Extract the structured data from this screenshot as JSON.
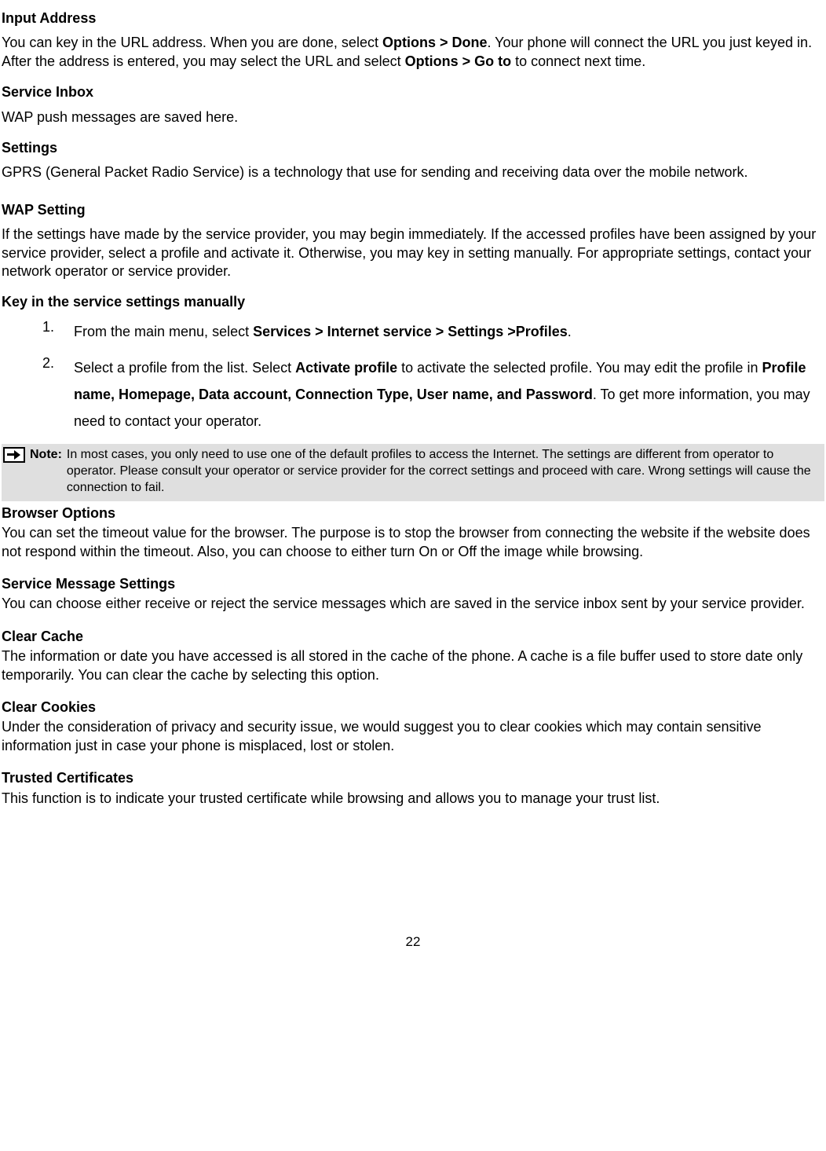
{
  "inputAddress": {
    "heading": "Input Address",
    "p1a": "You can key in the URL address. When you are done, select ",
    "p1b": "Options > Done",
    "p1c": ". Your phone will connect the URL you just keyed in. After the address is entered, you may select the URL and select ",
    "p1d": "Options > Go to",
    "p1e": " to connect next time."
  },
  "serviceInbox": {
    "heading": "Service Inbox",
    "p": "WAP push messages are saved here."
  },
  "settings": {
    "heading": "Settings",
    "p": "GPRS (General Packet Radio Service) is a technology that use for sending and receiving data over the mobile network."
  },
  "wapSetting": {
    "heading": "WAP Setting",
    "p": "If the settings have made by the service provider, you may begin immediately. If the accessed profiles have been assigned by your service provider, select a profile and activate it. Otherwise, you may key in setting manually. For appropriate settings, contact your network operator or service provider."
  },
  "keyInHeading": "Key in the service settings manually",
  "step1": {
    "num": "1.",
    "a": "From the main menu, select ",
    "b": "Services > Internet service > Settings >Profiles",
    "c": "."
  },
  "step2": {
    "num": "2.",
    "a": "Select a profile from the list. Select ",
    "b": "Activate profile",
    "c": " to activate the selected profile. You may edit the profile in ",
    "d": "Profile name, Homepage, Data account, Connection Type, User name, and Password",
    "e": ". To get more information, you may need to contact your operator."
  },
  "note": {
    "label": "Note",
    "colon": ":",
    "text": "In most cases, you only need to use one of the default profiles to access the Internet. The settings are different from operator to operator. Please consult your operator or service provider for the correct settings and proceed with care. Wrong settings will cause the connection to fail."
  },
  "browserOptions": {
    "heading": "Browser Options",
    "p": "You can set the timeout value for the browser. The purpose is to stop the browser from connecting the website if the website does not respond within the timeout. Also, you can choose to either turn On or Off the image while browsing."
  },
  "serviceMsg": {
    "heading": "Service Message Settings",
    "p": "You can choose either receive or reject the service messages which are saved in the service inbox sent by your service provider."
  },
  "clearCache": {
    "heading": "Clear Cache",
    "p": "The information or date you have accessed is all stored in the cache of the phone. A cache is a file buffer used to store date only temporarily. You can clear the cache by selecting this option."
  },
  "clearCookies": {
    "heading": "Clear Cookies",
    "p": "Under the consideration of privacy and security issue, we would suggest you to clear cookies which may contain sensitive information just in case your phone is misplaced, lost or stolen."
  },
  "trustedCerts": {
    "heading": "Trusted Certificates",
    "p": "This function is to indicate your trusted certificate while browsing and allows you to manage your trust list."
  },
  "pageNumber": "22"
}
